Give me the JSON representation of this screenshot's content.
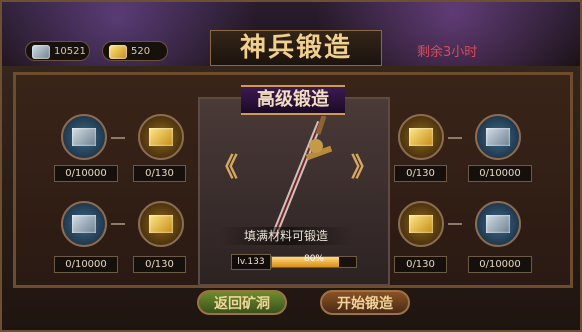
{
  "header": {
    "silver": "10521",
    "gold": "520",
    "title": "神兵锻造",
    "timer": "剩余3小时"
  },
  "forge": {
    "badge": "高级锻造",
    "message": "填满材料可锻造",
    "level": "lv.133",
    "progress_label": "80%",
    "progress": 0.8
  },
  "slots": [
    {
      "count": "0/10000"
    },
    {
      "count": "0/130"
    },
    {
      "count": "0/130"
    },
    {
      "count": "0/10000"
    },
    {
      "count": "0/10000"
    },
    {
      "count": "0/130"
    },
    {
      "count": "0/130"
    },
    {
      "count": "0/10000"
    }
  ],
  "buttons": {
    "back": "返回矿洞",
    "start": "开始锻造"
  },
  "icons": {
    "left_arrow": "chevron-left",
    "right_arrow": "chevron-right"
  }
}
